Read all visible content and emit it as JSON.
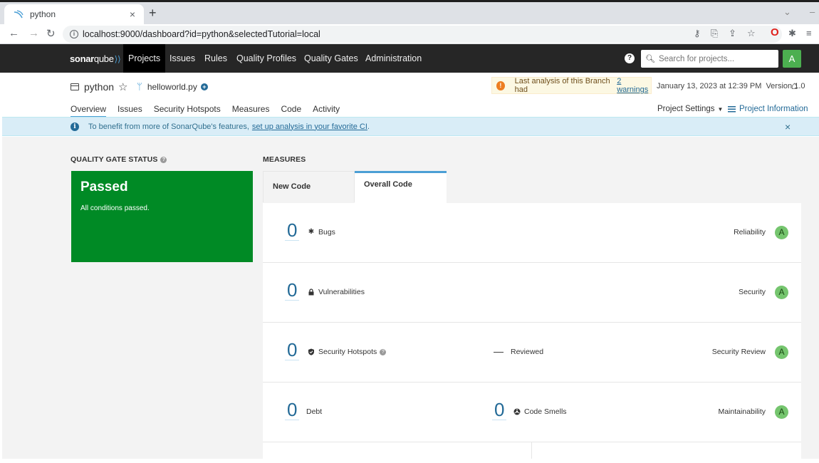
{
  "browser": {
    "tab_title": "python",
    "tab_close": "×",
    "new_tab": "+",
    "url": "localhost:9000/dashboard?id=python&selectedTutorial=local"
  },
  "nav": {
    "logo_bold": "sonar",
    "logo_rest": "qube",
    "items": [
      "Projects",
      "Issues",
      "Rules",
      "Quality Profiles",
      "Quality Gates",
      "Administration"
    ],
    "search_placeholder": "Search for projects...",
    "avatar_letter": "A"
  },
  "project": {
    "name": "python",
    "branch": "helloworld.py",
    "warning_text": "Last analysis of this Branch had",
    "warning_link": "2 warnings",
    "analysis_date": "January 13, 2023 at 12:39 PM",
    "version": "Version 1.0",
    "tabs": [
      "Overview",
      "Issues",
      "Security Hotspots",
      "Measures",
      "Code",
      "Activity"
    ],
    "settings_label": "Project Settings",
    "info_label": "Project Information"
  },
  "banner": {
    "text": "To benefit from more of SonarQube's features,",
    "link": "set up analysis in your favorite CI",
    "suffix": ".",
    "close": "×"
  },
  "quality_gate": {
    "title": "QUALITY GATE STATUS",
    "status": "Passed",
    "description": "All conditions passed.",
    "color": "#008a25"
  },
  "measures": {
    "title": "MEASURES",
    "tab_new": "New Code",
    "tab_overall": "Overall Code",
    "rows": [
      {
        "value": "0",
        "label": "Bugs",
        "icon": "bug-icon",
        "rating_label": "Reliability",
        "rating": "A"
      },
      {
        "value": "0",
        "label": "Vulnerabilities",
        "icon": "lock-icon",
        "rating_label": "Security",
        "rating": "A"
      },
      {
        "value": "0",
        "label": "Security Hotspots",
        "icon": "shield-icon",
        "mid_dash": "—",
        "mid_label": "Reviewed",
        "rating_label": "Security Review",
        "rating": "A"
      },
      {
        "value": "0",
        "label": "Debt",
        "mid_value": "0",
        "mid_label": "Code Smells",
        "mid_icon": "code-smell-icon",
        "rating_label": "Maintainability",
        "rating": "A"
      }
    ]
  }
}
